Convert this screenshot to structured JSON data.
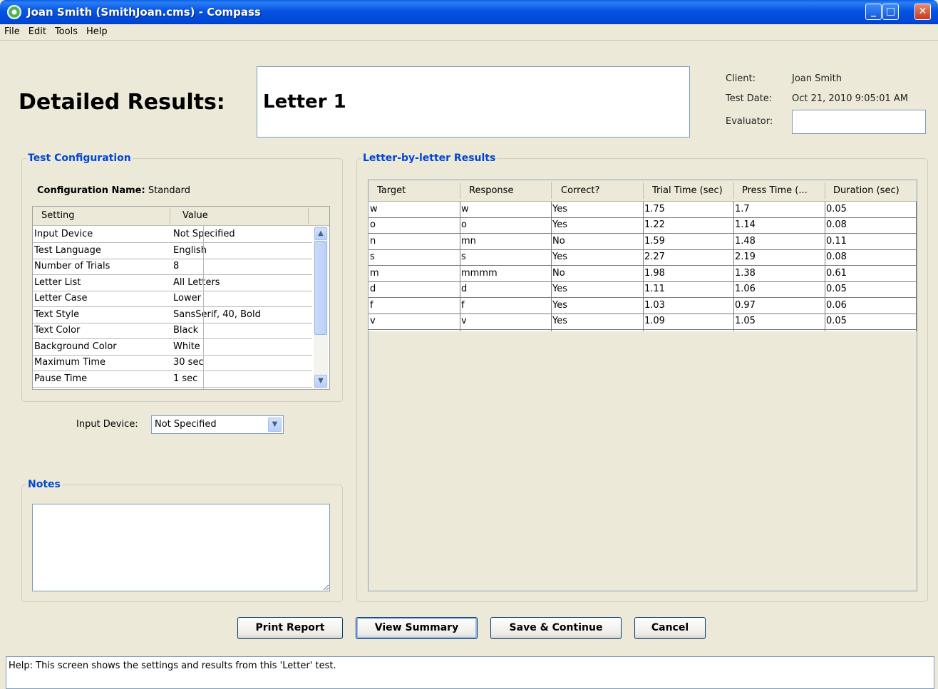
{
  "window": {
    "title": "Joan Smith (SmithJoan.cms) - Compass"
  },
  "menu": [
    "File",
    "Edit",
    "Tools",
    "Help"
  ],
  "header": {
    "title": "Detailed Results:",
    "test_name": "Letter 1",
    "client_label": "Client:",
    "client_value": "Joan Smith",
    "test_date_label": "Test Date:",
    "test_date_value": "Oct 21, 2010 9:05:01 AM",
    "evaluator_label": "Evaluator:",
    "evaluator_value": ""
  },
  "config": {
    "group_title": "Test Configuration",
    "name_label": "Configuration Name:",
    "name_value": "Standard",
    "columns": [
      "Setting",
      "Value"
    ],
    "rows": [
      [
        "Input Device",
        "Not Specified"
      ],
      [
        "Test Language",
        "English"
      ],
      [
        "Number of Trials",
        "8"
      ],
      [
        "Letter List",
        "All Letters"
      ],
      [
        "Letter Case",
        "Lower"
      ],
      [
        "Text Style",
        "SansSerif, 40, Bold"
      ],
      [
        "Text Color",
        "Black"
      ],
      [
        "Background Color",
        "White"
      ],
      [
        "Maximum Time",
        "30 sec"
      ],
      [
        "Pause Time",
        "1 sec"
      ]
    ]
  },
  "input_device": {
    "label": "Input Device:",
    "selected": "Not Specified"
  },
  "notes": {
    "group_title": "Notes",
    "value": ""
  },
  "results": {
    "group_title": "Letter-by-letter Results",
    "columns": [
      "Target",
      "Response",
      "Correct?",
      "Trial Time (sec)",
      "Press Time (...",
      "Duration (sec)"
    ],
    "rows": [
      [
        "w",
        "w",
        "Yes",
        "1.75",
        "1.7",
        "0.05"
      ],
      [
        "o",
        "o",
        "Yes",
        "1.22",
        "1.14",
        "0.08"
      ],
      [
        "n",
        "mn",
        "No",
        "1.59",
        "1.48",
        "0.11"
      ],
      [
        "s",
        "s",
        "Yes",
        "2.27",
        "2.19",
        "0.08"
      ],
      [
        "m",
        "mmmm",
        "No",
        "1.98",
        "1.38",
        "0.61"
      ],
      [
        "d",
        "d",
        "Yes",
        "1.11",
        "1.06",
        "0.05"
      ],
      [
        "f",
        "f",
        "Yes",
        "1.03",
        "0.97",
        "0.06"
      ],
      [
        "v",
        "v",
        "Yes",
        "1.09",
        "1.05",
        "0.05"
      ]
    ]
  },
  "buttons": {
    "print": "Print Report",
    "view_summary": "View Summary",
    "save_continue": "Save & Continue",
    "cancel": "Cancel"
  },
  "help": {
    "text": "Help:  This screen shows the settings and results from this 'Letter' test."
  },
  "colors": {
    "titlebar": "#0054e3",
    "group_title": "#0046d5",
    "window_bg": "#ece9d8"
  }
}
